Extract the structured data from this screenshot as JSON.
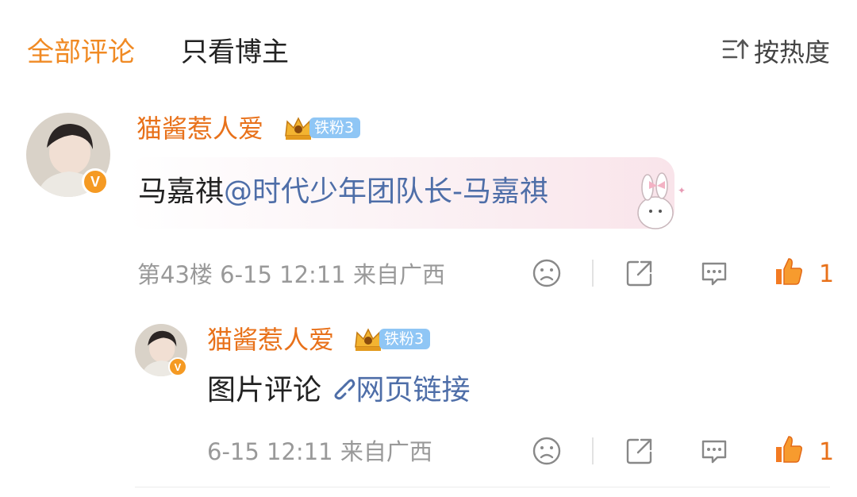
{
  "tabs": {
    "all_comments": "全部评论",
    "blogger_only": "只看博主"
  },
  "sort": {
    "label": "按热度",
    "icon": "sort-icon"
  },
  "comments": [
    {
      "username": "猫酱惹人爱",
      "fan_badge": "铁粉3",
      "text_prefix": "马嘉祺",
      "mention": "@时代少年团队长-马嘉祺",
      "floor_meta": "第43楼 6-15 12:11 来自广西",
      "like_count": "1"
    },
    {
      "username": "猫酱惹人爱",
      "fan_badge": "铁粉3",
      "text_prefix": "图片评论",
      "link_label": "网页链接",
      "meta": "6-15 12:11 来自广西",
      "like_count": "1"
    }
  ],
  "colors": {
    "accent": "#f08a24",
    "username": "#e8711a",
    "link": "#4e6ea8",
    "meta": "#999999",
    "fan_badge_bg": "#8fc6f5"
  }
}
